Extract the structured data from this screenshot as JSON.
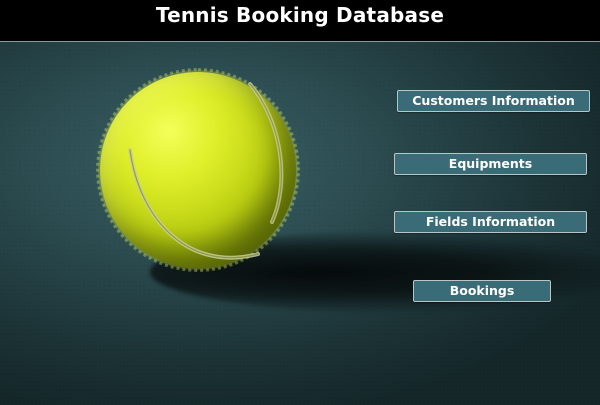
{
  "header": {
    "title": "Tennis Booking Database"
  },
  "background": {
    "image": "tennis-ball-on-court",
    "court_color": "#2a4a4e",
    "ball_color": "#d4e620"
  },
  "nav": {
    "customers_label": "Customers Information",
    "equipments_label": "Equipments",
    "fields_label": "Fields Information",
    "bookings_label": "Bookings"
  },
  "colors": {
    "button_fill": "#3a6c77",
    "button_border": "#b9c6c8",
    "title_bar": "#000000",
    "title_text": "#ffffff"
  }
}
